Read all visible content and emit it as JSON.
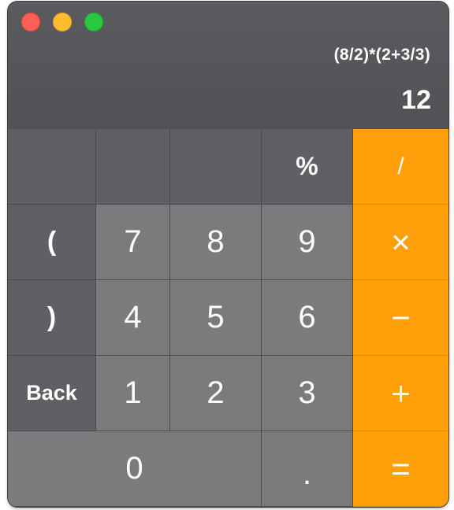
{
  "display": {
    "expression": "(8/2)*(2+3/3)",
    "result": "12"
  },
  "keys": {
    "blank1": "",
    "blank2": "",
    "blank3": "",
    "percent": "%",
    "divide": "/",
    "open_paren": "(",
    "seven": "7",
    "eight": "8",
    "nine": "9",
    "multiply": "×",
    "close_paren": ")",
    "four": "4",
    "five": "5",
    "six": "6",
    "minus": "−",
    "back": "Back",
    "one": "1",
    "two": "2",
    "three": "3",
    "plus": "+",
    "zero": "0",
    "decimal": ".",
    "equals": "="
  },
  "colors": {
    "operator": "#ff9f0a",
    "digit_key": "#7a7b7d",
    "function_key": "#5f6063",
    "display_bg": "#505255"
  }
}
